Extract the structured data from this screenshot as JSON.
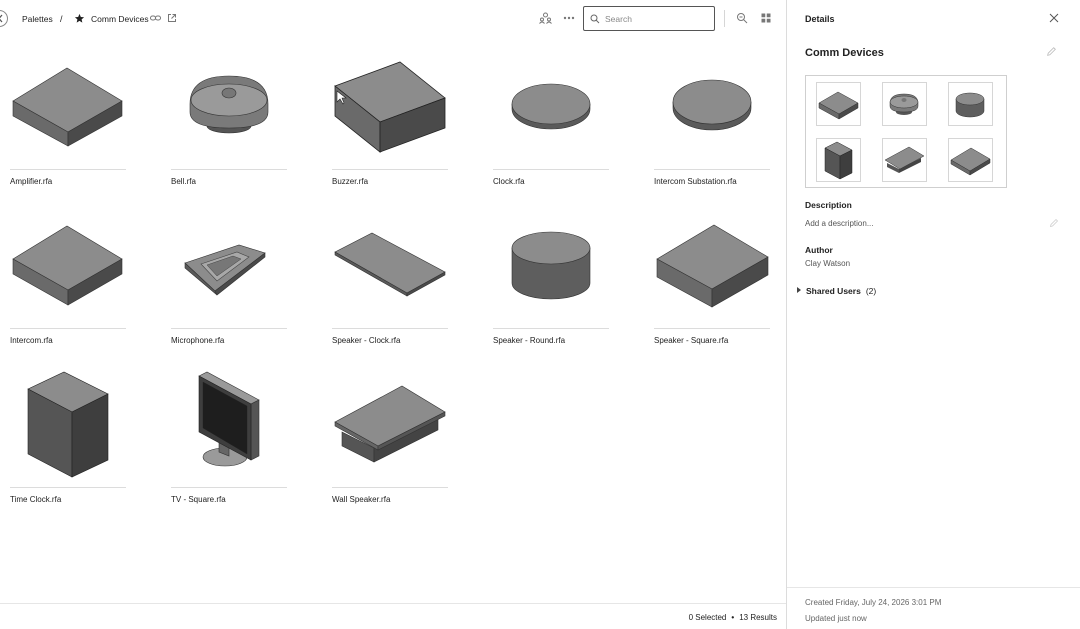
{
  "breadcrumb": {
    "root": "Palettes",
    "separator": "/",
    "current": "Comm Devices"
  },
  "search": {
    "placeholder": "Search",
    "value": ""
  },
  "items": [
    {
      "name": "Amplifier.rfa",
      "icon": "amplifier-model"
    },
    {
      "name": "Bell.rfa",
      "icon": "bell-model"
    },
    {
      "name": "Buzzer.rfa",
      "icon": "buzzer-model"
    },
    {
      "name": "Clock.rfa",
      "icon": "clock-model"
    },
    {
      "name": "Intercom Substation.rfa",
      "icon": "intercom-substation-model"
    },
    {
      "name": "Intercom.rfa",
      "icon": "intercom-model"
    },
    {
      "name": "Microphone.rfa",
      "icon": "microphone-model"
    },
    {
      "name": "Speaker - Clock.rfa",
      "icon": "speaker-clock-model"
    },
    {
      "name": "Speaker - Round.rfa",
      "icon": "speaker-round-model"
    },
    {
      "name": "Speaker - Square.rfa",
      "icon": "speaker-square-model"
    },
    {
      "name": "Time Clock.rfa",
      "icon": "time-clock-model"
    },
    {
      "name": "TV - Square.rfa",
      "icon": "tv-model"
    },
    {
      "name": "Wall Speaker.rfa",
      "icon": "wall-speaker-model"
    }
  ],
  "footer": {
    "selected": "0 Selected",
    "dot": "•",
    "results": "13 Results"
  },
  "details": {
    "title": "Details",
    "name": "Comm Devices",
    "description_label": "Description",
    "description_placeholder": "Add a description...",
    "author_label": "Author",
    "author": "Clay Watson",
    "shared_label": "Shared Users",
    "shared_count": "(2)",
    "created": "Created Friday, July 24, 2026 3:01 PM",
    "updated": "Updated just now"
  },
  "colors": {
    "model_top": "#8c8c8c",
    "model_left": "#6a6a6a",
    "model_right": "#4a4a4a",
    "accent_border": "#555555"
  }
}
